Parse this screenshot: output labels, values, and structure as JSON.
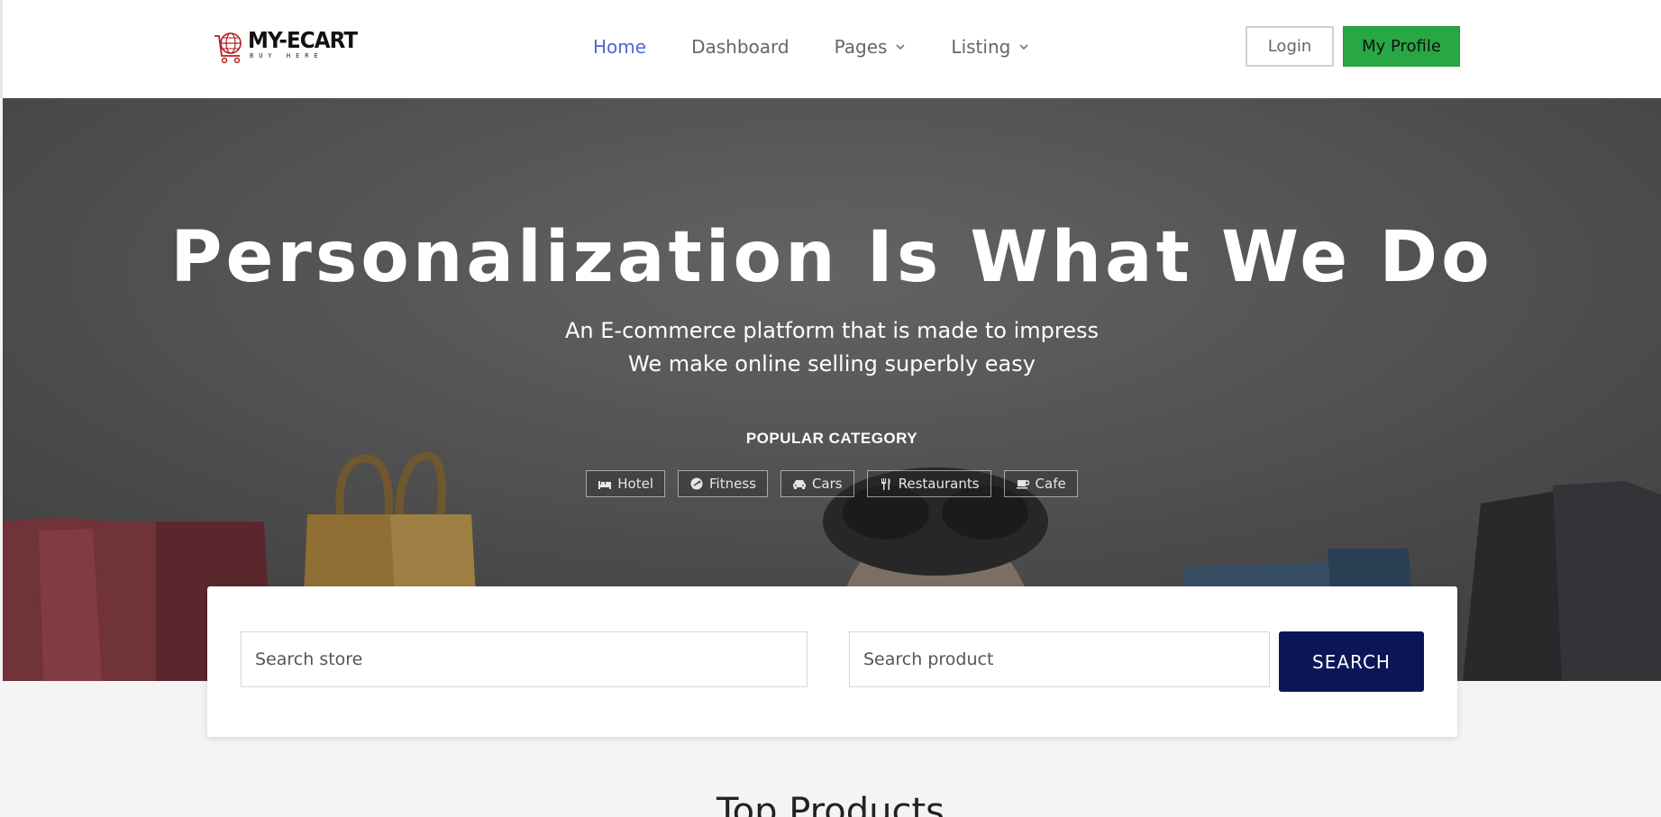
{
  "brand": {
    "name": "MY-ECART",
    "tagline": "BUY HERE"
  },
  "nav": {
    "items": [
      {
        "label": "Home",
        "active": true,
        "dropdown": false
      },
      {
        "label": "Dashboard",
        "active": false,
        "dropdown": false
      },
      {
        "label": "Pages",
        "active": false,
        "dropdown": true
      },
      {
        "label": "Listing",
        "active": false,
        "dropdown": true
      }
    ],
    "login_label": "Login",
    "profile_label": "My Profile"
  },
  "hero": {
    "title": "Personalization Is What We Do",
    "subtitle_line1": "An E-commerce platform that is made to impress",
    "subtitle_line2": "We make online selling superbly easy",
    "popular_label": "POPULAR CATEGORY",
    "categories": [
      {
        "label": "Hotel",
        "icon": "bed-icon"
      },
      {
        "label": "Fitness",
        "icon": "fitness-icon"
      },
      {
        "label": "Cars",
        "icon": "car-icon"
      },
      {
        "label": "Restaurants",
        "icon": "utensils-icon"
      },
      {
        "label": "Cafe",
        "icon": "coffee-icon"
      }
    ]
  },
  "search": {
    "store_placeholder": "Search store",
    "product_placeholder": "Search product",
    "button_label": "SEARCH"
  },
  "section": {
    "title": "Top Products"
  },
  "colors": {
    "accent_nav": "#4a67d6",
    "profile_button": "#28a745",
    "search_button": "#0b1659"
  }
}
